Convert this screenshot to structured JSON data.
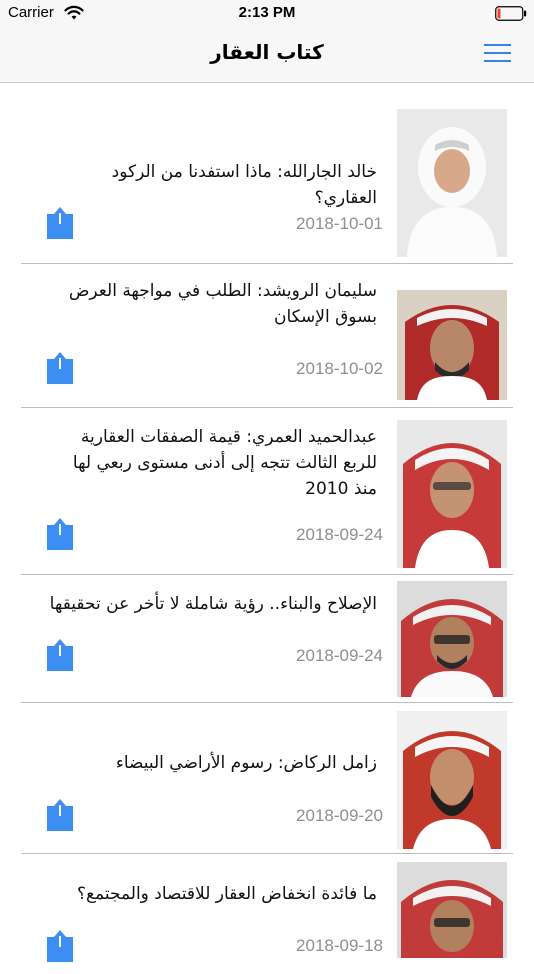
{
  "status_bar": {
    "carrier": "Carrier",
    "time": "2:13 PM",
    "wifi_icon": "wifi-icon",
    "battery_icon": "battery-low-icon",
    "battery_color": "#ff3b30"
  },
  "nav": {
    "title": "كتاب العقار",
    "menu_icon": "hamburger-menu-icon",
    "accent_color": "#3b82e8"
  },
  "articles": [
    {
      "title": "خالد الجارالله: ماذا استفدنا من الركود العقاري؟",
      "date": "2018-10-01",
      "share_icon": "share-icon",
      "image": "author-photo"
    },
    {
      "title": "سليمان الرويشد: الطلب في مواجهة العرض بسوق الإسكان",
      "date": "2018-10-02",
      "share_icon": "share-icon",
      "image": "author-photo"
    },
    {
      "title": "عبدالحميد العمري: قيمة الصفقات العقارية للربع الثالث تتجه إلى أدنى مستوى ربعي لها منذ 2010",
      "date": "2018-09-24",
      "share_icon": "share-icon",
      "image": "author-photo"
    },
    {
      "title": "الإصلاح والبناء.. رؤية شاملة لا تأخر عن تحقيقها",
      "date": "2018-09-24",
      "share_icon": "share-icon",
      "image": "author-photo"
    },
    {
      "title": "زامل الركاض: رسوم الأراضي البيضاء",
      "date": "2018-09-20",
      "share_icon": "share-icon",
      "image": "author-photo"
    },
    {
      "title": "ما فائدة انخفاض العقار للاقتصاد والمجتمع؟",
      "date": "2018-09-18",
      "share_icon": "share-icon",
      "image": "author-photo"
    }
  ]
}
